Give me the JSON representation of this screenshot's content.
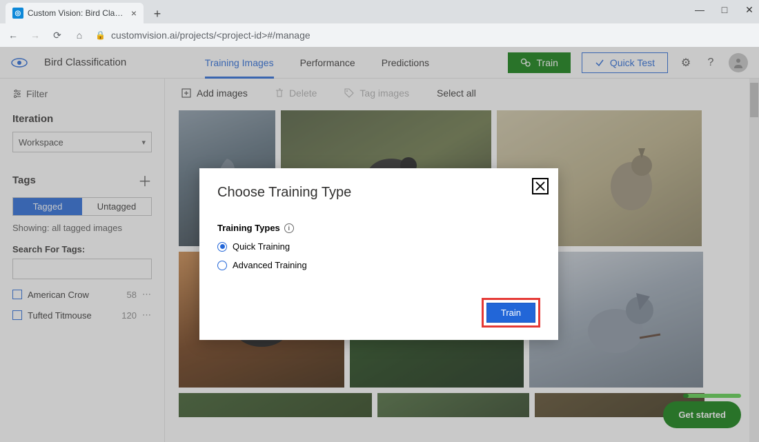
{
  "browser": {
    "tab_title": "Custom Vision: Bird Classification",
    "url_display": "customvision.ai/projects/<project-id>#/manage",
    "url_host": "customvision.ai"
  },
  "header": {
    "project_name": "Bird Classification",
    "nav": {
      "training_images": "Training Images",
      "performance": "Performance",
      "predictions": "Predictions"
    },
    "train_btn": "Train",
    "quick_test_btn": "Quick Test"
  },
  "sidebar": {
    "filter_label": "Filter",
    "iteration_label": "Iteration",
    "iteration_value": "Workspace",
    "tags_label": "Tags",
    "seg_tagged": "Tagged",
    "seg_untagged": "Untagged",
    "showing": "Showing: all tagged images",
    "search_label": "Search For Tags:",
    "tags": [
      {
        "name": "American Crow",
        "count": "58"
      },
      {
        "name": "Tufted Titmouse",
        "count": "120"
      }
    ]
  },
  "toolbar": {
    "add_images": "Add images",
    "delete": "Delete",
    "tag_images": "Tag images",
    "select_all": "Select all"
  },
  "modal": {
    "title": "Choose Training Type",
    "section": "Training Types",
    "opt_quick": "Quick Training",
    "opt_advanced": "Advanced Training",
    "train_btn": "Train"
  },
  "getstarted": "Get started"
}
